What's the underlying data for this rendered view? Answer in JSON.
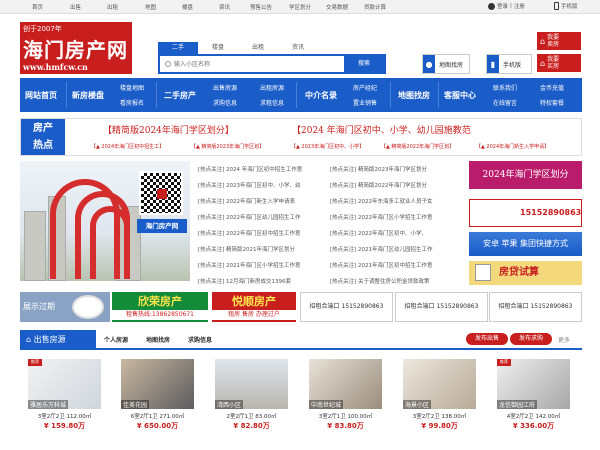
{
  "topbar": {
    "links": [
      "首页",
      "出售",
      "出租",
      "地图",
      "楼盘",
      "资讯",
      "预售公告",
      "学区划分",
      "交易数据",
      "贷款计算"
    ],
    "login": "登录",
    "divider": "|",
    "register": "注册",
    "mobile": "手机版"
  },
  "logo": {
    "since": "创于2007年",
    "name": "海门房产网",
    "url": "www.hmfcw.cn"
  },
  "search": {
    "tabs": [
      "二手",
      "楼盘",
      "出租",
      "资讯"
    ],
    "placeholder": "输入小区名称",
    "button": "搜索"
  },
  "map_button": "地图找房",
  "mobile_button": "手机版",
  "side_buttons": [
    {
      "label": "我要\n卖房"
    },
    {
      "label": "我要\n买房"
    }
  ],
  "nav": {
    "home": "网站首页",
    "newhouse": "新房楼盘",
    "newhouse_sub": [
      "楼盘地图",
      "看房报名"
    ],
    "secondhand": "二手房产",
    "secondhand_sub": [
      "出售房源",
      "求购信息",
      "出租房源",
      "求租信息"
    ],
    "agent": "中介名录",
    "agent_sub": [
      "房产经纪",
      "置业销售"
    ],
    "mapsearch": "地图找房",
    "service": "客服中心",
    "service_sub": [
      "联系我们",
      "在线留言",
      "金币充值",
      "特权套餐"
    ]
  },
  "hot": {
    "label": "房产\n热点",
    "headline1": "【精简版2024年海门学区划分】",
    "headline2": "【2024 年海门区初中、小学、幼儿园施教范",
    "subs": [
      "【▲ 2024年海门区初中招生工】",
      "【▲ 精简版2023年海门学区划】",
      "【▲ 2023年海门区初中、小学】",
      "【▲ 精简版2022年海门学区划】",
      "【▲ 2024年海门新生入学申请】"
    ]
  },
  "photo_caption": "海门房产网",
  "news_left": [
    "[热点关注] 2024 年海门区初中招生工作意",
    "[热点关注] 2023年海门区初中、小学、幼",
    "[热点关注] 2022年海门新生入学申请表",
    "[热点关注] 2022年海门区幼儿园招生工作",
    "[热点关注] 2022年海门区初中招生工作意",
    "[热点关注] 精简版2021年海门学区划分",
    "[热点关注] 2021年海门区小学招生工作意",
    "[热点关注] 12月海门新房成交1396套"
  ],
  "news_right": [
    "[热点关注] 精简版2023年海门学区划分",
    "[热点关注] 精简版2022年海门学区划分",
    "[热点关注] 2022年东海多工就业人员子女",
    "[热点关注] 2022年海门区小学招生工作意",
    "[热点关注] 2022年海门区初中、小学、",
    "[热点关注] 2021年海门区幼儿园招生工作",
    "[热点关注] 2021年海门区初中招生工作意",
    "[热点关注] 关于调整住房公积金贷款政策"
  ],
  "ads_right": {
    "a1": "2024年海门学区划分",
    "a2": "15152890863",
    "a3": "安卓 苹果 集团快捷方式",
    "a4": "房贷试算"
  },
  "band": {
    "expired": "展示过期",
    "xin_title": "欣荣房产",
    "xin_sub": "租售热线:13862850671",
    "yue_title": "悦顺房产",
    "yue_sub": "租房 售房 办理过户",
    "zhaozu": [
      "招租合端口 15152890863",
      "招租合端口 15152890863",
      "招租合端口 15152890863"
    ]
  },
  "section": {
    "title": "出售房源",
    "tabs": [
      "个人房源",
      "地图找房",
      "求购信息"
    ],
    "publish_sale": "发布出售",
    "publish_buy": "发布求购",
    "more": "更多"
  },
  "listings": [
    {
      "name": "雅居乐万科城",
      "tag": "推荐",
      "spec": "3室2厅2卫 112.00㎡",
      "price": "¥ 159.80万"
    },
    {
      "name": "佳美花园",
      "tag": "",
      "spec": "6室2厅1卫 271.00㎡",
      "price": "¥ 650.00万"
    },
    {
      "name": "湾西小区",
      "tag": "",
      "spec": "2室2厅1卫 83.00㎡",
      "price": "¥ 82.80万"
    },
    {
      "name": "中南世纪城",
      "tag": "",
      "spec": "3室2厅1卫 100.00㎡",
      "price": "¥ 83.80万"
    },
    {
      "name": "海景小区",
      "tag": "",
      "spec": "3室2厅2卫 138.00㎡",
      "price": "¥ 99.80万"
    },
    {
      "name": "龙信御园江府",
      "tag": "推荐",
      "spec": "4室2厅2卫 142.00㎡",
      "price": "¥ 336.00万"
    }
  ]
}
